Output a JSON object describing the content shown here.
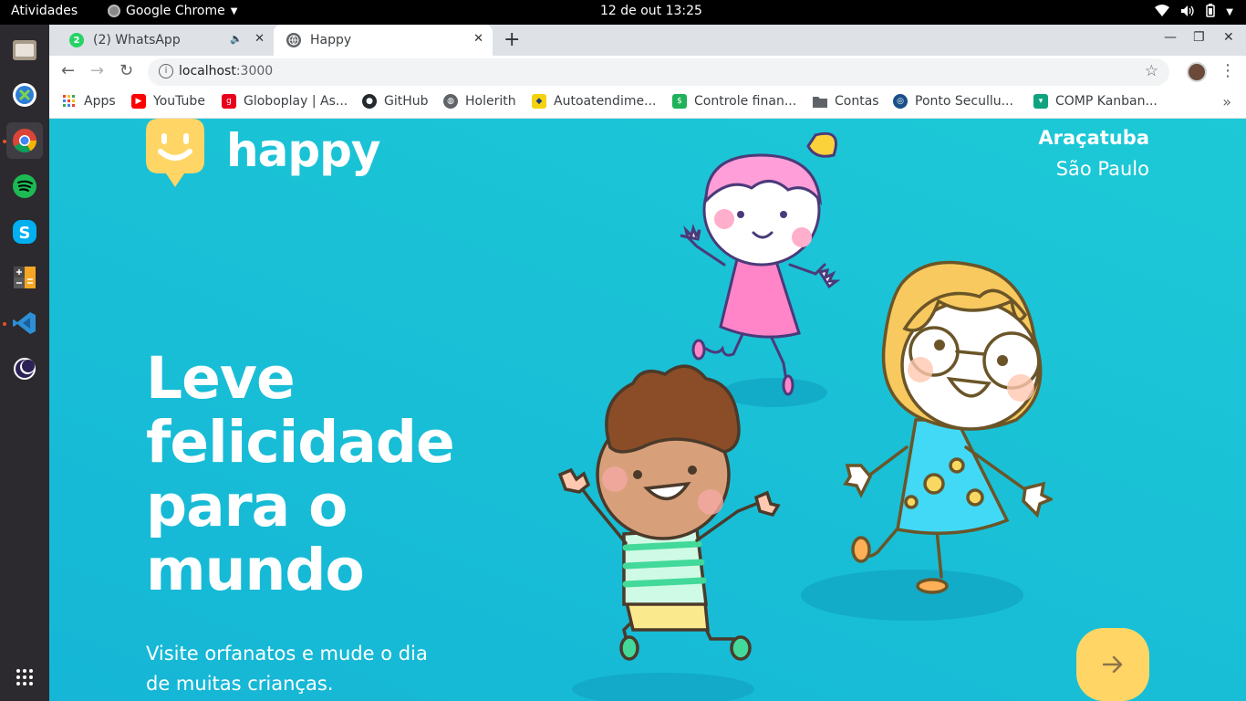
{
  "system_bar": {
    "activities": "Atividades",
    "app_name": "Google Chrome",
    "clock": "12 de out  13:25"
  },
  "dock": {
    "apps": [
      "Files",
      "Remote Desktop",
      "Google Chrome",
      "Spotify",
      "Skype",
      "Calculator",
      "Visual Studio Code",
      "Eclipse"
    ]
  },
  "browser": {
    "tabs": [
      {
        "title": "(2) WhatsApp",
        "badge": "2",
        "active": false
      },
      {
        "title": "Happy",
        "active": true
      }
    ],
    "url_host": "localhost",
    "url_port": ":3000",
    "bookmarks": [
      {
        "label": "Apps",
        "icon": "apps-grid-icon"
      },
      {
        "label": "YouTube",
        "icon": "youtube-icon"
      },
      {
        "label": "Globoplay | As...",
        "icon": "globoplay-icon"
      },
      {
        "label": "GitHub",
        "icon": "github-icon"
      },
      {
        "label": "Holerith",
        "icon": "globe-icon"
      },
      {
        "label": "Autoatendime...",
        "icon": "bank-icon"
      },
      {
        "label": "Controle finan...",
        "icon": "dollar-icon"
      },
      {
        "label": "Contas",
        "icon": "folder-icon"
      },
      {
        "label": "Ponto Secullu...",
        "icon": "secullum-icon"
      },
      {
        "label": "COMP Kanban...",
        "icon": "kanban-icon"
      }
    ]
  },
  "landing": {
    "logo_text": "happy",
    "location_city": "Araçatuba",
    "location_state": "São Paulo",
    "headline_lines": [
      "Leve",
      "felicidade",
      "para o",
      "mundo"
    ],
    "subtitle_lines": [
      "Visite orfanatos e mude o dia",
      "de muitas crianças."
    ],
    "enter_icon": "arrow-right-icon",
    "colors": {
      "background": "#15c3d6",
      "logo": "#ffd666",
      "button": "#ffd666",
      "button_arrow": "#8d734b"
    }
  }
}
